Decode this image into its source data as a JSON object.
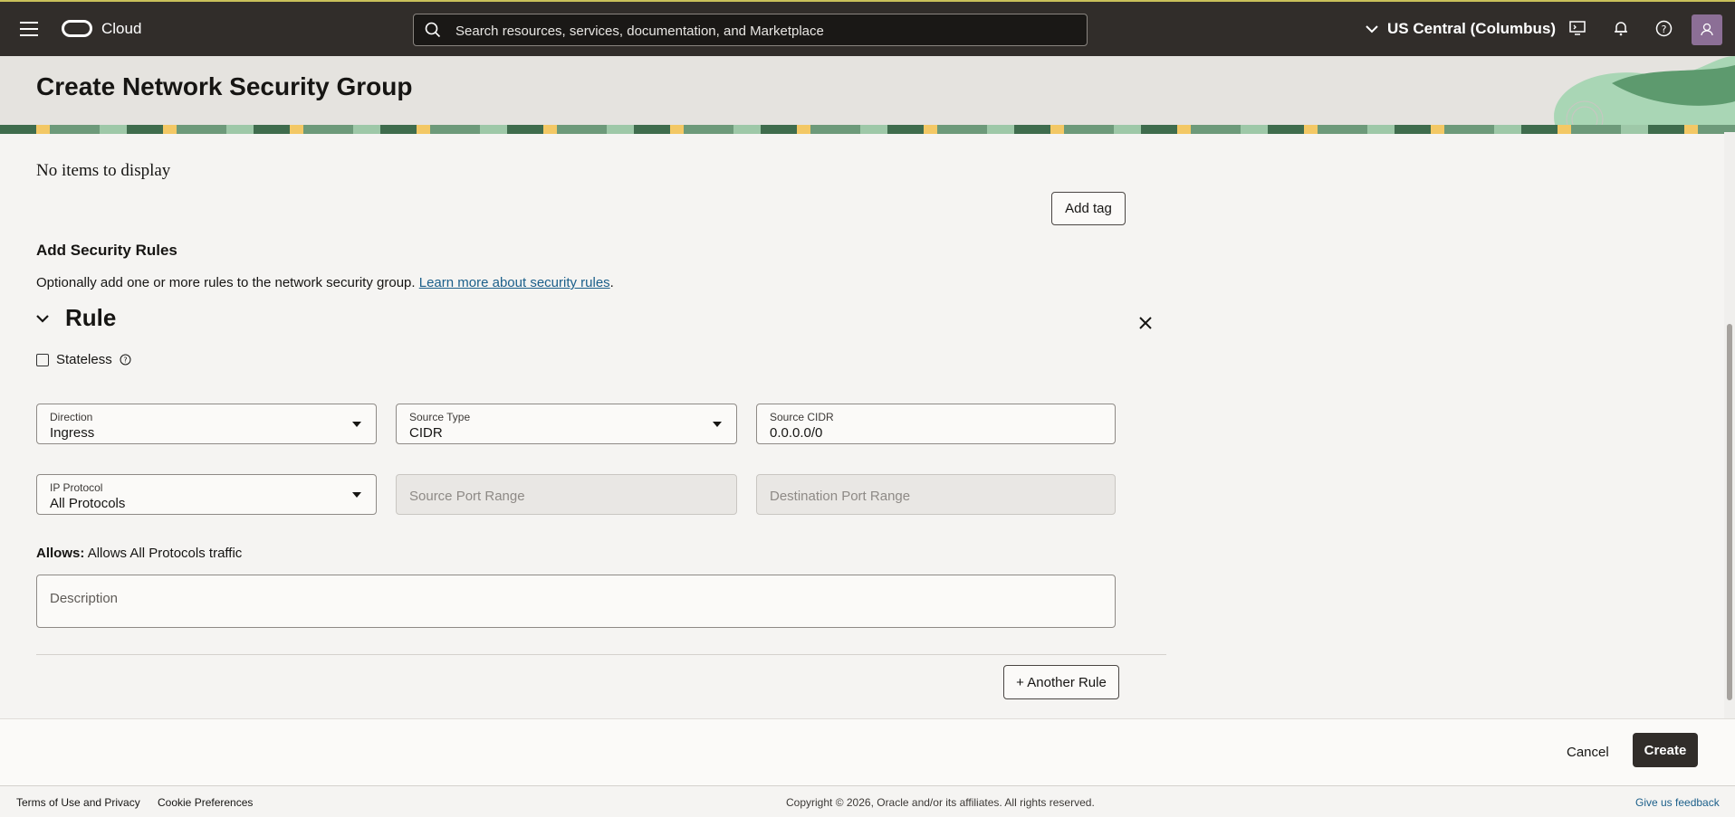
{
  "topbar": {
    "brand": "Cloud",
    "search_placeholder": "Search resources, services, documentation, and Marketplace",
    "region": "US Central (Columbus)"
  },
  "page": {
    "title": "Create Network Security Group"
  },
  "tags": {
    "empty_text": "No items to display",
    "add_tag_label": "Add tag"
  },
  "rules": {
    "section_title": "Add Security Rules",
    "helper_text": "Optionally add one or more rules to the network security group.",
    "helper_link": "Learn more about security rules",
    "helper_suffix": ".",
    "rule_title": "Rule",
    "stateless_label": "Stateless",
    "direction": {
      "label": "Direction",
      "value": "Ingress"
    },
    "source_type": {
      "label": "Source Type",
      "value": "CIDR"
    },
    "source_cidr": {
      "label": "Source CIDR",
      "value": "0.0.0.0/0"
    },
    "ip_protocol": {
      "label": "IP Protocol",
      "value": "All Protocols"
    },
    "source_port_placeholder": "Source Port Range",
    "dest_port_placeholder": "Destination Port Range",
    "allows_label": "Allows:",
    "allows_text": "Allows All Protocols traffic",
    "description_placeholder": "Description",
    "another_rule_label": "+ Another Rule"
  },
  "actions": {
    "cancel": "Cancel",
    "create": "Create"
  },
  "footer": {
    "terms": "Terms of Use and Privacy",
    "cookies": "Cookie Preferences",
    "copyright": "Copyright © 2026, Oracle and/or its affiliates. All rights reserved.",
    "feedback": "Give us feedback"
  }
}
